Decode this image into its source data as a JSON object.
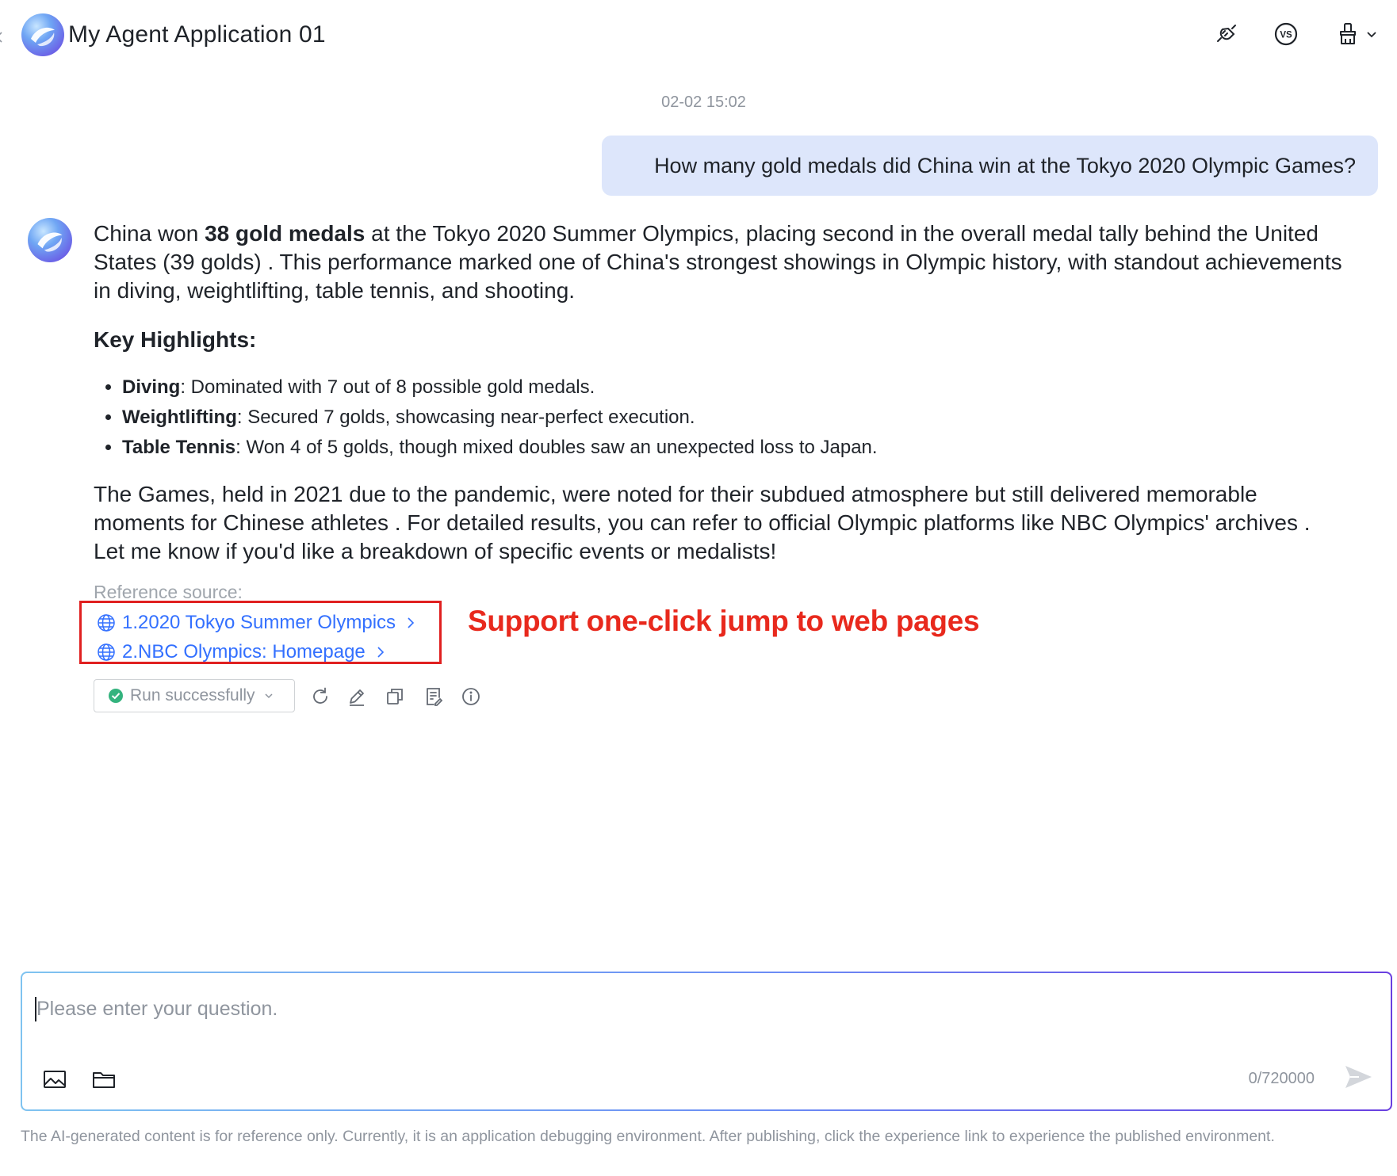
{
  "header": {
    "title": "My Agent Application 01",
    "icons": [
      "back-chevron-icon",
      "app-logo",
      "plug-icon",
      "vs-icon",
      "broom-icon",
      "chevron-down-icon"
    ]
  },
  "conversation": {
    "timestamp": "02-02 15:02",
    "user_message": "How many gold medals did China win at the Tokyo 2020 Olympic Games?",
    "answer": {
      "p1_before": "China won ",
      "p1_bold": "38 gold medals",
      "p1_after": " at the Tokyo 2020 Summer Olympics, placing second in the overall medal tally behind the United States (39 golds) . This performance marked one of China's strongest showings in Olympic history, with standout achievements in diving, weightlifting, table tennis, and shooting.",
      "highlights_heading": "Key Highlights:",
      "highlights": [
        {
          "label": "Diving",
          "text": ": Dominated with 7 out of 8 possible gold medals."
        },
        {
          "label": "Weightlifting",
          "text": ": Secured 7 golds, showcasing near-perfect execution."
        },
        {
          "label": "Table Tennis",
          "text": ": Won 4 of 5 golds, though mixed doubles saw an unexpected loss to Japan."
        }
      ],
      "p3": "The Games, held in 2021 due to the pandemic, were noted for their subdued atmosphere but still delivered memorable moments for Chinese athletes . For detailed results, you can refer to official Olympic platforms like NBC Olympics' archives . Let me know if you'd like a breakdown of specific events or medalists!"
    },
    "references": {
      "title": "Reference source:",
      "links": [
        "1.2020 Tokyo Summer Olympics",
        "2.NBC Olympics: Homepage"
      ]
    },
    "annotation": "Support one-click jump to web pages",
    "actions": {
      "status_label": "Run successfully",
      "status_color": "#34b37e",
      "icons": [
        "refresh-icon",
        "edit-icon",
        "copy-icon",
        "note-icon",
        "info-icon"
      ]
    }
  },
  "input": {
    "placeholder": "Please enter your question.",
    "value": "",
    "char_count": "0/720000",
    "icons": [
      "image-icon",
      "folder-icon",
      "send-icon"
    ]
  },
  "footer": {
    "disclaimer": "The AI-generated content is for reference only. Currently, it is an application debugging environment. After publishing, click the experience link to experience the published environment."
  },
  "colors": {
    "accent": "#3370ff",
    "user_bubble": "#dde6fb",
    "annotation_red": "#e8291d"
  }
}
